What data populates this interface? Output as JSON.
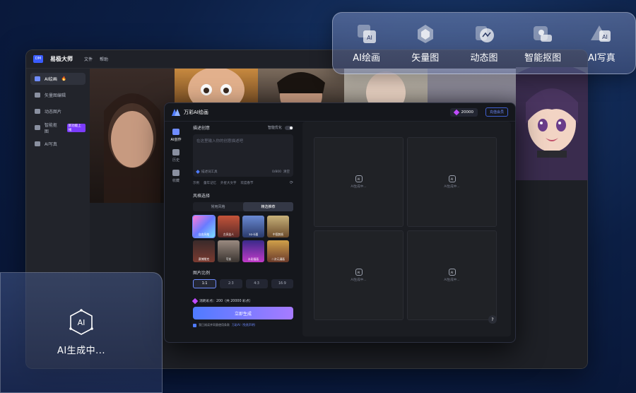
{
  "app": {
    "logo_badge": "DM",
    "name": "易极大师",
    "menu": [
      "文件",
      "帮助"
    ]
  },
  "sidebar": {
    "items": [
      {
        "label": "AI绘画",
        "icon": "picture-ai-icon",
        "active": true,
        "badge": "🔥"
      },
      {
        "label": "矢量图编辑",
        "icon": "vector-icon",
        "active": false
      },
      {
        "label": "动态图片",
        "icon": "motion-icon",
        "active": false
      },
      {
        "label": "智能抠图",
        "icon": "cutout-icon",
        "active": false,
        "tag": "新功能上线"
      },
      {
        "label": "AI写真",
        "icon": "portrait-icon",
        "active": false
      }
    ]
  },
  "features": [
    {
      "label": "AI绘画",
      "icon": "ai-paint-icon"
    },
    {
      "label": "矢量图",
      "icon": "vector-icon"
    },
    {
      "label": "动态图",
      "icon": "motion-icon"
    },
    {
      "label": "智能抠图",
      "icon": "smart-cutout-icon"
    },
    {
      "label": "AI写真",
      "icon": "ai-portrait-icon"
    }
  ],
  "dialog": {
    "title": "万彩AI绘画",
    "credits": "20000",
    "recharge": "充值会员",
    "side_tabs": [
      "AI创作",
      "历史",
      "收藏"
    ],
    "prompt_label": "描述创意",
    "optimize_label": "智能优化",
    "prompt_placeholder": "在这里输入你的创意描述吧",
    "prompt_tool": "描述词工具",
    "char_count": "0/800",
    "clear": "清空",
    "tags": [
      "示例",
      "童年记忆",
      "外星大文字",
      "欢度春节"
    ],
    "style_label": "风格选择",
    "style_tabs": [
      "常用风格",
      "精选推荐"
    ],
    "styles": [
      "自由风格",
      "古风佳人",
      "3D卡通",
      "中国剪纸",
      "赛博朋克",
      "写实",
      "水彩插画",
      "二次元漫画"
    ],
    "ratio_label": "图片比例",
    "ratios": [
      "1:1",
      "2:3",
      "4:3",
      "16:9"
    ],
    "cost": "消耗彩点：200（共 20000 彩点）",
    "generate": "立即生成",
    "agree_text": "我已阅读并同意使用条款",
    "agree_link": "万彩AI（免责声明）",
    "generating": "AI生成中...",
    "cell_ai": "AI",
    "help": "?"
  },
  "gen_card": {
    "icon_text": "AI",
    "text": "AI生成中..."
  },
  "colors": {
    "accent": "#4f7bff",
    "accent2": "#a77bff",
    "gem": "#c04bff",
    "hot": "#ff6a3d"
  }
}
